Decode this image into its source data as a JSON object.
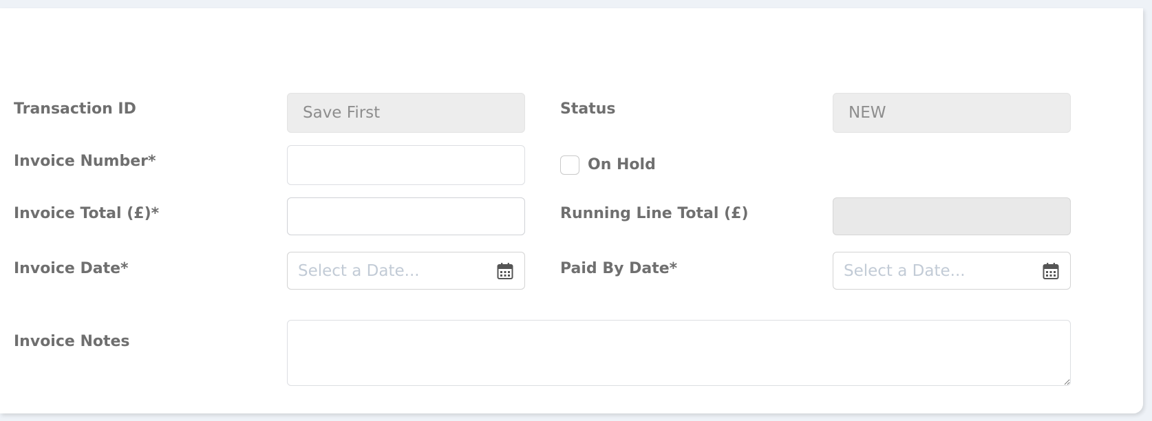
{
  "form": {
    "transaction_id": {
      "label": "Transaction ID",
      "value": "Save First"
    },
    "status": {
      "label": "Status",
      "value": "NEW"
    },
    "invoice_number": {
      "label": "Invoice Number*",
      "value": ""
    },
    "on_hold": {
      "label": "On Hold",
      "checked": false
    },
    "invoice_total": {
      "label": "Invoice Total (£)*",
      "value": ""
    },
    "running_line_total": {
      "label": "Running Line Total (£)",
      "value": ""
    },
    "invoice_date": {
      "label": "Invoice Date*",
      "placeholder": "Select a Date...",
      "icon": "calendar-icon"
    },
    "paid_by_date": {
      "label": "Paid By Date*",
      "placeholder": "Select a Date...",
      "icon": "calendar-icon"
    },
    "invoice_notes": {
      "label": "Invoice Notes",
      "value": ""
    }
  },
  "colors": {
    "label": "#6f6f6f",
    "readonly_bg": "#ededed",
    "placeholder": "#c2cbd6",
    "page_bg": "#eef2f7"
  }
}
